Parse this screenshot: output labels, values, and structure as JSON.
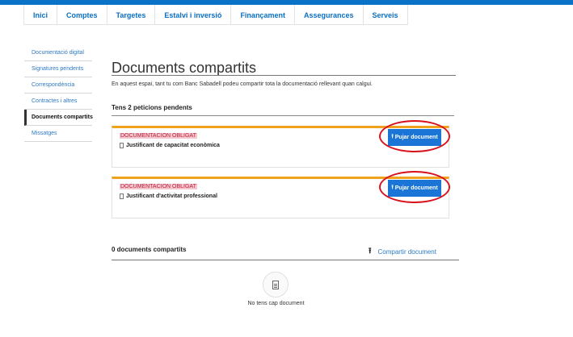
{
  "nav": {
    "items": [
      "Inici",
      "Comptes",
      "Targetes",
      "Estalvi i inversió",
      "Finançament",
      "Assegurances",
      "Serveis"
    ]
  },
  "sidebar": {
    "items": [
      {
        "label": "Documentació digital",
        "active": false
      },
      {
        "label": "Signatures pendents",
        "active": false
      },
      {
        "label": "Correspondència",
        "active": false
      },
      {
        "label": "Contractes i altres",
        "active": false
      },
      {
        "label": "Documents compartits",
        "active": true
      },
      {
        "label": "Missatges",
        "active": false
      }
    ]
  },
  "main": {
    "title": "Documents compartits",
    "intro": "En aquest espai, tant tu com Banc Sabadell podeu compartir tota la documentació rellevant quan calgui.",
    "pending_title": "Tens 2 peticions pendents",
    "requests": [
      {
        "tag": "DOCUMENTACION OBLIGAT",
        "document": "Justificant de capacitat econòmica",
        "button": "Pujar document"
      },
      {
        "tag": "DOCUMENTACION OBLIGAT",
        "document": "Justificant d'activitat professional",
        "button": "Pujar document"
      }
    ],
    "shared_title": "0 documents compartits",
    "share_link": "Compartir document",
    "empty_text": "No tens cap document"
  },
  "colors": {
    "brand_blue": "#0a73c8",
    "button_blue": "#1a75d6",
    "accent_orange": "#f0a21f",
    "highlight_ring_red": "#d8121b",
    "tag_red": "#c21f3a"
  },
  "icons": {
    "document": "file-icon",
    "upload": "upload-arrow-icon",
    "share": "upload-arrow-icon",
    "empty": "file-icon"
  }
}
